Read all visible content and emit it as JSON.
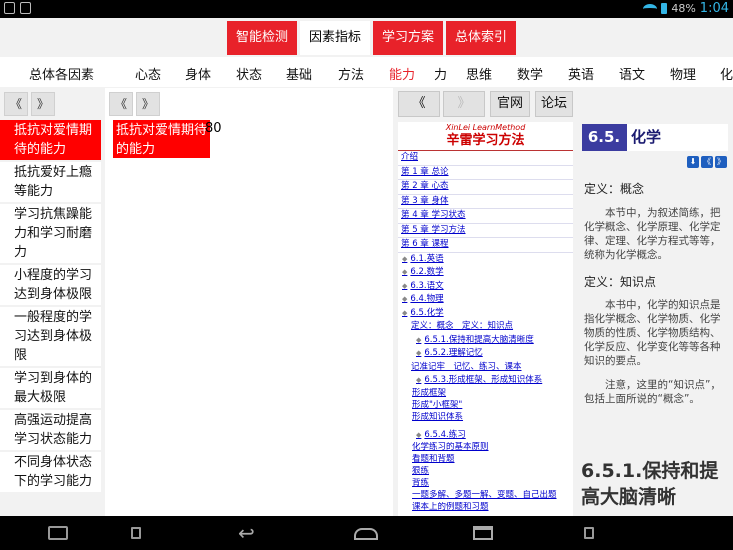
{
  "status": {
    "battery": "48%",
    "time": "1:04"
  },
  "top_tabs": [
    {
      "label": "智能检测",
      "active": false
    },
    {
      "label": "因素指标",
      "active": true
    },
    {
      "label": "学习方案",
      "active": false
    },
    {
      "label": "总体索引",
      "active": false
    }
  ],
  "categories": [
    "总体各因素",
    "心态",
    "身体",
    "状态",
    "基础",
    "方法",
    "能力",
    "力",
    "思维",
    "数学",
    "英语",
    "语文",
    "物理",
    "化"
  ],
  "active_category": "能力",
  "col1": {
    "prev": "《",
    "next": "》",
    "items": [
      "抵抗对爱情期待的能力",
      "抵抗爱好上瘾等能力",
      "学习抗焦躁能力和学习耐磨力",
      "小程度的学习达到身体极限",
      "一般程度的学习达到身体极限",
      "学习到身体的最大极限",
      "高强运动提高学习状态能力",
      "不同身体状态下的学习能力"
    ]
  },
  "col2": {
    "prev": "《",
    "next": "》",
    "selected": "抵抗对爱情期待的能力",
    "value": "80"
  },
  "col3": {
    "prev": "《",
    "next": "》",
    "btn_official": "官网",
    "btn_forum": "论坛",
    "book": {
      "subtitle": "XinLei LearnMethod",
      "title": "辛雷学习方法",
      "intro": "介绍",
      "chapters": [
        "第 1 章 总论",
        "第 2 章 心态",
        "第 3 章 身体",
        "第 4 章 学习状态",
        "第 5 章 学习方法",
        "第 6 章 课程"
      ],
      "sub_sections": [
        "6.1.英语",
        "6.2.数学",
        "6.3.语文",
        "6.4.物理",
        "6.5.化学"
      ],
      "def_links": "定义：概念　定义：知识点",
      "s651": "6.5.1.保持和提高大脑清晰度",
      "s652": "6.5.2.理解记忆",
      "s652_links": "记准记牢　记忆、练习、课本",
      "s653": "6.5.3.形成框架、形成知识体系",
      "s653_links": [
        "形成框架",
        "形成\"小框架\"",
        "形成知识体系"
      ],
      "s654": "6.5.4.练习",
      "s654_links": [
        "化学练习的基本原则",
        "看题和背题",
        "狠练",
        "背练",
        "一题多解、多题一解、变题、自己出题",
        "课本上的例题和习题"
      ]
    },
    "content": {
      "sec_num": "6.5.",
      "sec_title": "化学",
      "pager": [
        "⬇",
        "《",
        "》"
      ],
      "def1_head": "定义：概念",
      "def1_text": "本节中，为叙述简练，把化学概念、化学原理、化学定律、定理、化学方程式等等，统称为化学概念。",
      "def2_head": "定义：知识点",
      "def2_text": "本书中，化学的知识点是指化学概念、化学物质、化学物质的性质、化学物质结构、化学反应、化学变化等等各种知识的要点。",
      "note": "注意，这里的“知识点”，包括上面所说的“概念”。",
      "big_head": "6.5.1.保持和提高大脑清晰"
    }
  }
}
